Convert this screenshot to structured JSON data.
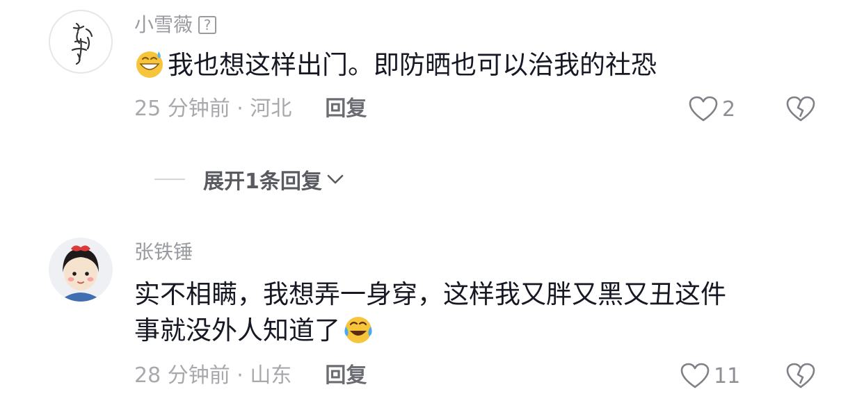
{
  "comments": [
    {
      "username": "小雪薇",
      "badge": "?",
      "emoji": "grin-sweat-emoji",
      "text": "我也想这样出门。即防晒也可以治我的社恐",
      "time_location": "25 分钟前 · 河北",
      "reply_label": "回复",
      "like_count": "2"
    },
    {
      "username": "张铁锤",
      "text_line1": "实不相瞒，我想弄一身穿，这样我又胖又黑又丑这件",
      "text_line2": "事就没外人知道了",
      "emoji": "laugh-cry-emoji",
      "time_location": "28 分钟前 · 山东",
      "reply_label": "回复",
      "like_count": "11"
    }
  ],
  "expand_replies": {
    "label": "展开1条回复"
  },
  "colors": {
    "primary_text": "#161823",
    "secondary_text": "#9a9ba0",
    "reply_text": "#6b6c72"
  }
}
